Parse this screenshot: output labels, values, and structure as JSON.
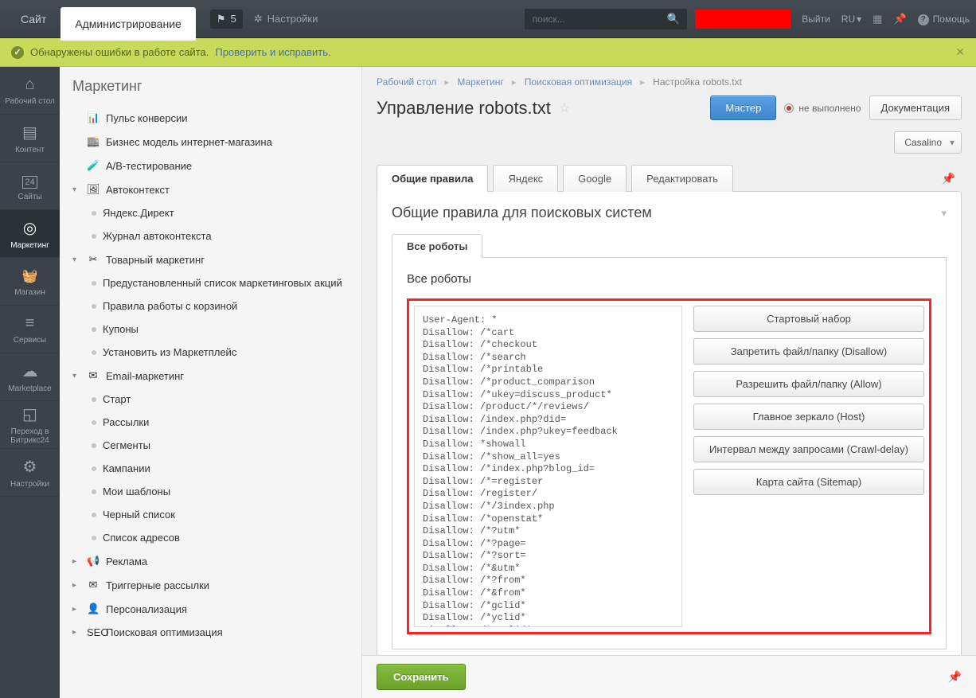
{
  "topbar": {
    "site_tab": "Сайт",
    "admin_tab": "Администрирование",
    "notif_count": "5",
    "settings": "Настройки",
    "search_placeholder": "поиск...",
    "exit": "Выйти",
    "lang": "RU",
    "help": "Помощь"
  },
  "alert": {
    "text": "Обнаружены ошибки в работе сайта.",
    "link": "Проверить и исправить."
  },
  "leftnav": [
    {
      "label": "Рабочий стол",
      "icon": "i-house"
    },
    {
      "label": "Контент",
      "icon": "i-doc"
    },
    {
      "label": "Сайты",
      "icon": "i-cal"
    },
    {
      "label": "Маркетинг",
      "icon": "i-target",
      "active": true
    },
    {
      "label": "Магазин",
      "icon": "i-basket"
    },
    {
      "label": "Сервисы",
      "icon": "i-layers"
    },
    {
      "label": "Marketplace",
      "icon": "i-cloud"
    },
    {
      "label": "Переход в Битрикс24",
      "icon": "i-b24"
    },
    {
      "label": "Настройки",
      "icon": "i-gear"
    }
  ],
  "sidebar": {
    "title": "Маркетинг",
    "items": [
      {
        "expand": "",
        "icon": "📊",
        "label": "Пульс конверсии"
      },
      {
        "expand": "",
        "icon": "🏬",
        "label": "Бизнес модель интернет-магазина"
      },
      {
        "expand": "",
        "icon": "🧪",
        "label": "A/B-тестирование"
      },
      {
        "expand": "▾",
        "icon": "🖼",
        "label": "Автоконтекст"
      },
      {
        "child": true,
        "label": "Яндекс.Директ"
      },
      {
        "child": true,
        "label": "Журнал автоконтекста"
      },
      {
        "expand": "▾",
        "icon": "✂",
        "label": "Товарный маркетинг"
      },
      {
        "child": true,
        "label": "Предустановленный список маркетинговых акций"
      },
      {
        "child": true,
        "label": "Правила работы с корзиной"
      },
      {
        "child": true,
        "label": "Купоны"
      },
      {
        "child": true,
        "label": "Установить из Маркетплейс"
      },
      {
        "expand": "▾",
        "icon": "✉",
        "label": "Email-маркетинг"
      },
      {
        "child": true,
        "label": "Старт"
      },
      {
        "child": true,
        "label": "Рассылки"
      },
      {
        "child": true,
        "label": "Сегменты"
      },
      {
        "child": true,
        "label": "Кампании"
      },
      {
        "child": true,
        "label": "Мои шаблоны"
      },
      {
        "child": true,
        "label": "Черный список"
      },
      {
        "child": true,
        "label": "Список адресов"
      },
      {
        "expand": "▸",
        "icon": "📢",
        "label": "Реклама"
      },
      {
        "expand": "▸",
        "icon": "✉",
        "label": "Триггерные рассылки"
      },
      {
        "expand": "▸",
        "icon": "👤",
        "label": "Персонализация"
      },
      {
        "expand": "▸",
        "icon": "SEO",
        "label": "Поисковая оптимизация"
      }
    ]
  },
  "breadcrumb": [
    "Рабочий стол",
    "Маркетинг",
    "Поисковая оптимизация",
    "Настройка robots.txt"
  ],
  "page_title": "Управление robots.txt",
  "master_btn": "Мастер",
  "status_label": "не выполнено",
  "doc_btn": "Документация",
  "site_select": "Casalino",
  "tabs": [
    "Общие правила",
    "Яндекс",
    "Google",
    "Редактировать"
  ],
  "panel_title": "Общие правила для поисковых систем",
  "inner_tab": "Все роботы",
  "inner_heading": "Все роботы",
  "robots_txt": "User-Agent: *\nDisallow: /*cart\nDisallow: /*checkout\nDisallow: /*search\nDisallow: /*printable\nDisallow: /*product_comparison\nDisallow: /*ukey=discuss_product*\nDisallow: /product/*/reviews/\nDisallow: /index.php?did=\nDisallow: /index.php?ukey=feedback\nDisallow: *showall\nDisallow: /*show_all=yes\nDisallow: /*index.php?blog_id=\nDisallow: /*=register\nDisallow: /register/\nDisallow: /*/3index.php\nDisallow: /*openstat*\nDisallow: /*?utm*\nDisallow: /*?page=\nDisallow: /*?sort=\nDisallow: /*&utm*\nDisallow: /*?from*\nDisallow: /*&from*\nDisallow: /*gclid*\nDisallow: /*yclid*\nDisallow: /*ymclid*\nDisallow: /*?tid*\nDisallow: /*&tid*\nDisallow: /tag/\nDisallow: /my-account/\nDisallow: /logout/",
  "action_buttons": [
    "Стартовый набор",
    "Запретить файл/папку (Disallow)",
    "Разрешить файл/папку (Allow)",
    "Главное зеркало (Host)",
    "Интервал между запросами (Crawl-delay)",
    "Карта сайта (Sitemap)"
  ],
  "save_btn": "Сохранить"
}
